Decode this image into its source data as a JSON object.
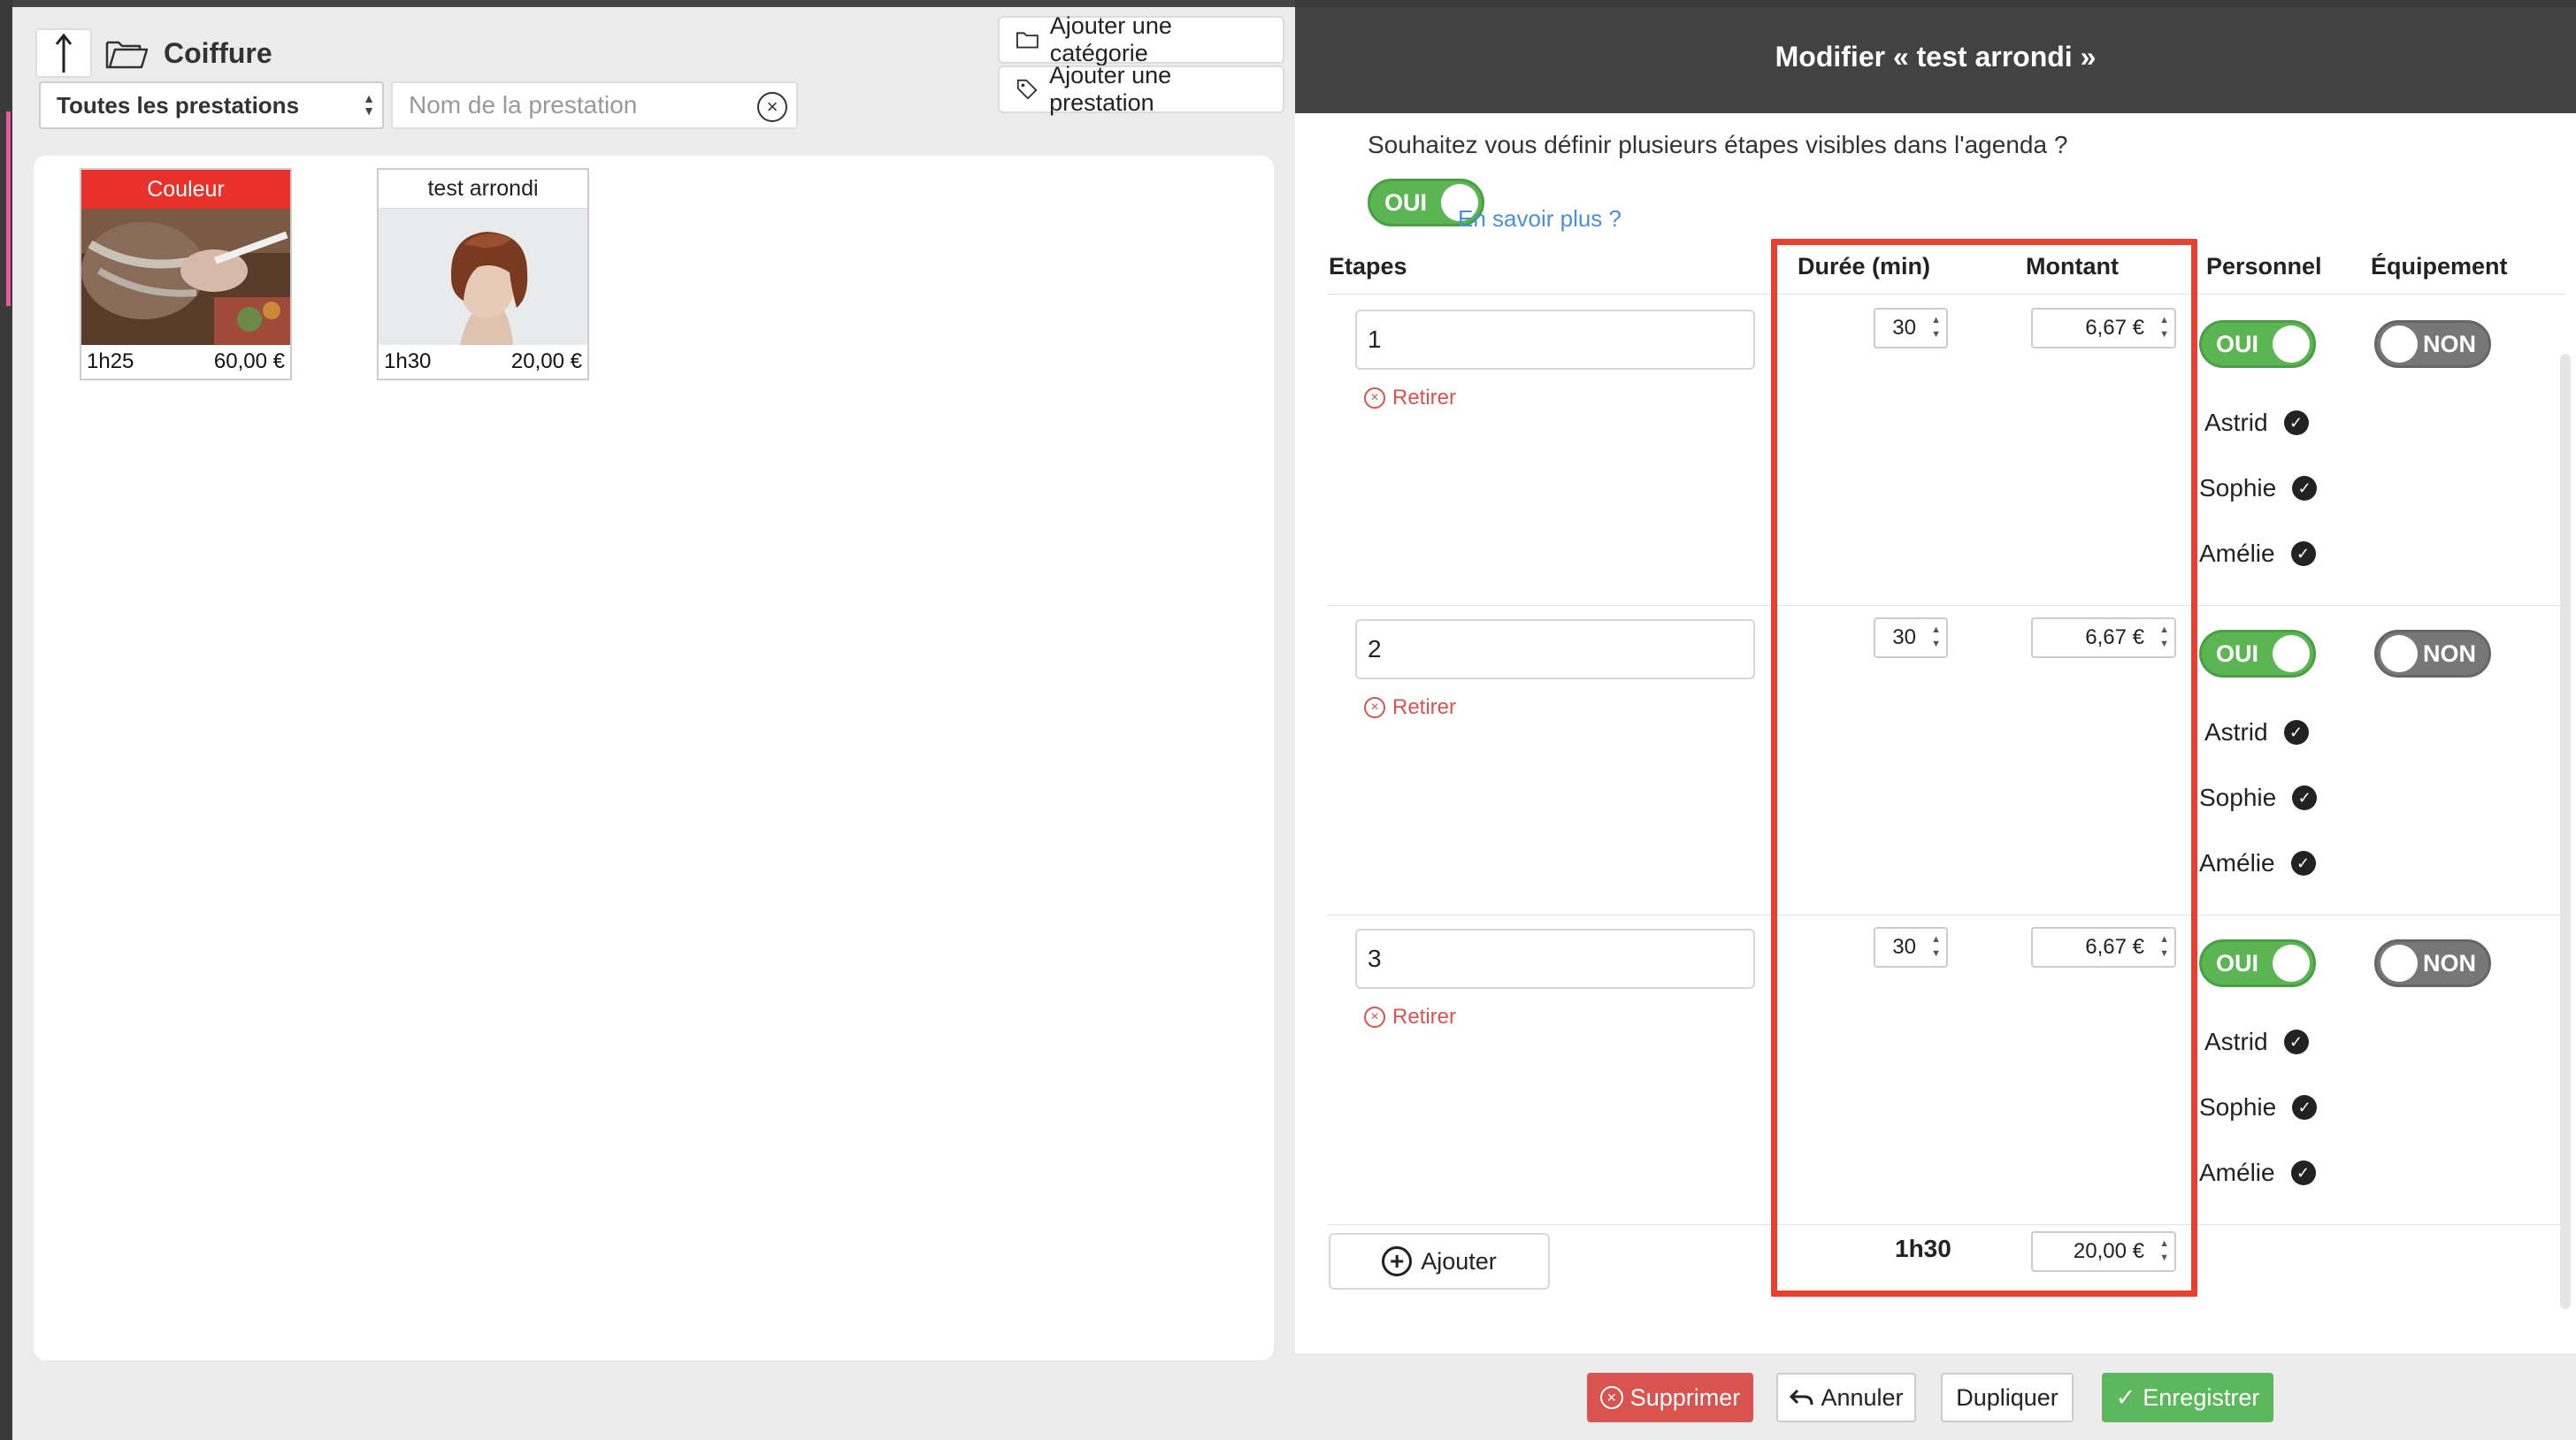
{
  "left": {
    "breadcrumb": "Coiffure",
    "add_category_label": "Ajouter une catégorie",
    "add_service_label": "Ajouter une prestation",
    "filter_selected": "Toutes les prestations",
    "search_placeholder": "Nom de la prestation",
    "services": [
      {
        "title": "Couleur",
        "duration": "1h25",
        "price": "60,00 €"
      },
      {
        "title": "test arrondi",
        "duration": "1h30",
        "price": "20,00 €"
      }
    ]
  },
  "modal": {
    "title": "Modifier « test arrondi »",
    "question": "Souhaitez vous définir plusieurs étapes visibles dans l'agenda ?",
    "toggle_on_label": "OUI",
    "toggle_off_label": "NON",
    "learn_more": "En savoir plus ?",
    "columns": {
      "steps": "Etapes",
      "duration": "Durée (min)",
      "amount": "Montant",
      "staff": "Personnel",
      "equipment": "Équipement"
    },
    "remove_label": "Retirer",
    "steps": [
      {
        "name": "1",
        "duration": "30",
        "amount": "6,67 €",
        "staff_enabled": true,
        "equipment_enabled": false,
        "staff": [
          "Astrid",
          "Sophie",
          "Amélie"
        ]
      },
      {
        "name": "2",
        "duration": "30",
        "amount": "6,67 €",
        "staff_enabled": true,
        "equipment_enabled": false,
        "staff": [
          "Astrid",
          "Sophie",
          "Amélie"
        ]
      },
      {
        "name": "3",
        "duration": "30",
        "amount": "6,67 €",
        "staff_enabled": true,
        "equipment_enabled": false,
        "staff": [
          "Astrid",
          "Sophie",
          "Amélie"
        ]
      }
    ],
    "add_label": "Ajouter",
    "total_duration": "1h30",
    "total_amount": "20,00 €",
    "footer": {
      "delete": "Supprimer",
      "cancel": "Annuler",
      "duplicate": "Dupliquer",
      "save": "Enregistrer"
    },
    "colors": {
      "toggle_on": "#5ab552",
      "toggle_off": "#777777",
      "highlight_frame": "#e8402f",
      "danger": "#d9534f",
      "success": "#5cb85c"
    }
  }
}
